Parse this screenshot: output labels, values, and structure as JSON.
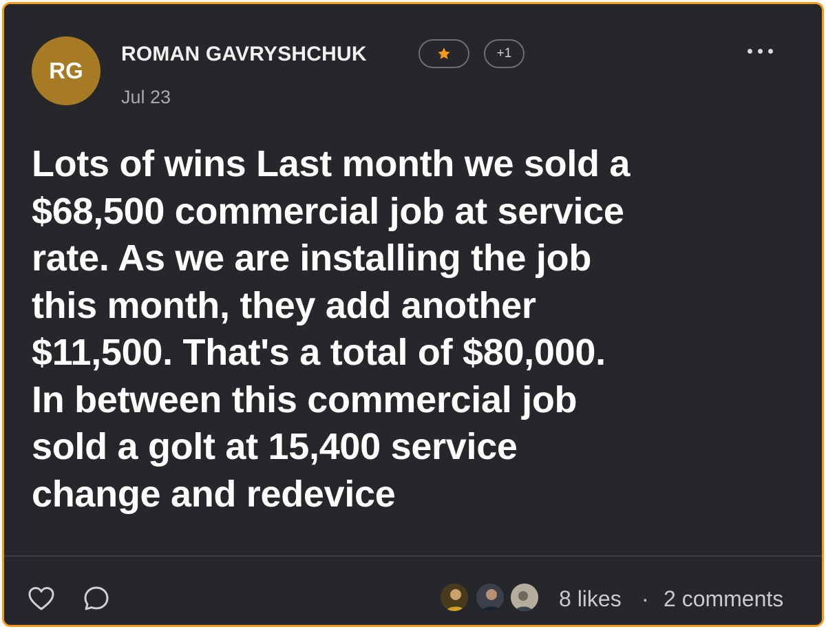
{
  "post": {
    "author": {
      "initials": "RG",
      "name": "ROMAN GAVRYSHCHUK",
      "avatar_color": "#a77a24"
    },
    "badges": {
      "star_icon": "star-icon",
      "star_color": "#f39a1e",
      "plus_label": "+1"
    },
    "date": "Jul 23",
    "body": "Lots of wins Last month we sold a\n$68,500 commercial job at service\nrate. As we are installing the job\nthis month, they add another\n$11,500. That's a total of $80,000.\nIn between this commercial job\nsold a golt at 15,400 service\nchange and redevice",
    "stats": {
      "likes": "8 likes",
      "separator": "·",
      "comments": "2 comments"
    }
  },
  "theme": {
    "card_background": "#25272b",
    "border_color": "#f39a1e"
  },
  "icons": {
    "menu": "more-horizontal-icon",
    "like": "heart-icon",
    "comment": "comment-bubble-icon"
  }
}
